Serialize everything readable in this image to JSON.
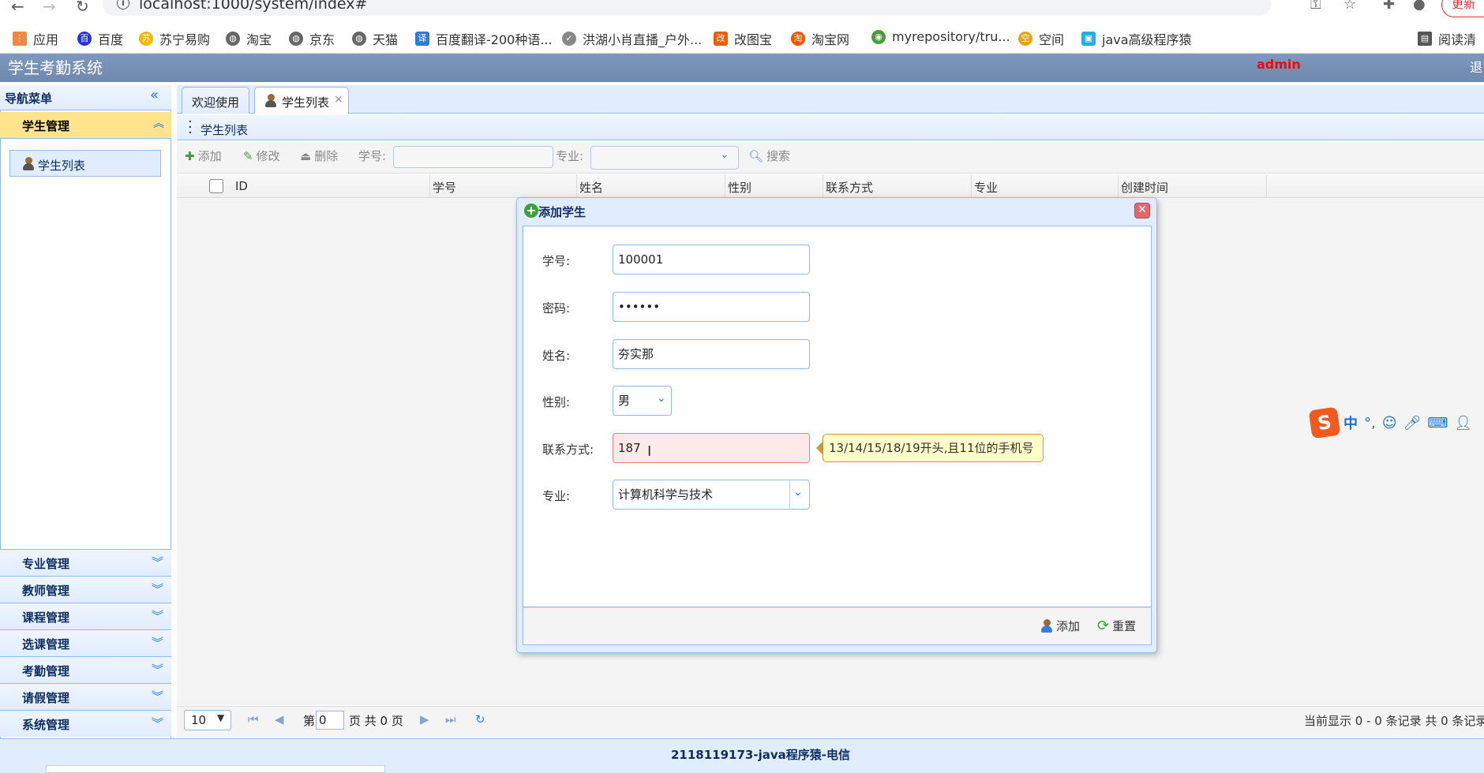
{
  "browser": {
    "url": "localhost:1000/system/index#",
    "update_label": "更新",
    "bookmarks": [
      "应用",
      "百度",
      "苏宁易购",
      "淘宝",
      "京东",
      "天猫",
      "百度翻译-200种语...",
      "洪湖小肖直播_户外...",
      "改图宝",
      "淘宝网",
      "myrepository/tru...",
      "空间",
      "java高级程序猿"
    ],
    "reading_list": "阅读清"
  },
  "app": {
    "title": "学生考勤系统",
    "user": "admin",
    "logout": "退"
  },
  "sidebar": {
    "title": "导航菜单",
    "active_section": "学生管理",
    "active_item": "学生列表",
    "sections": [
      "专业管理",
      "教师管理",
      "课程管理",
      "选课管理",
      "考勤管理",
      "请假管理",
      "系统管理"
    ]
  },
  "tabs": [
    {
      "label": "欢迎使用"
    },
    {
      "label": "学生列表",
      "close": "×"
    }
  ],
  "panel": {
    "title": "学生列表",
    "toolbar": {
      "add": "添加",
      "edit": "修改",
      "delete": "删除",
      "sn_label": "学号:",
      "major_label": "专业:",
      "search": "搜索"
    },
    "columns": [
      "ID",
      "学号",
      "姓名",
      "性别",
      "联系方式",
      "专业",
      "创建时间"
    ]
  },
  "pager": {
    "page_size": "10",
    "page_prefix": "第",
    "page_value": "0",
    "page_suffix": "页 共 0 页",
    "info": "当前显示 0 - 0 条记录 共 0 条记录"
  },
  "dialog": {
    "title": "添加学生",
    "fields": {
      "sn": {
        "label": "学号:",
        "value": "100001"
      },
      "password": {
        "label": "密码:",
        "value": "••••••"
      },
      "name": {
        "label": "姓名:",
        "value": "夯实那"
      },
      "gender": {
        "label": "性别:",
        "value": "男"
      },
      "phone": {
        "label": "联系方式:",
        "value": "187"
      },
      "major": {
        "label": "专业:",
        "value": "计算机科学与技术"
      }
    },
    "phone_tip": "13/14/15/18/19开头,且11位的手机号",
    "add_button": "添加",
    "reset_button": "重置"
  },
  "footer": {
    "text": "2118119173-java程序猿-电信"
  },
  "ime": {
    "logo": "S",
    "mode": "中"
  },
  "colors": {
    "header_blue": "#7f99be",
    "panel_blue": "#e0ecff",
    "active_yellow": "#ffe48d",
    "border_blue": "#95b8e7",
    "admin_red": "#e01010"
  }
}
